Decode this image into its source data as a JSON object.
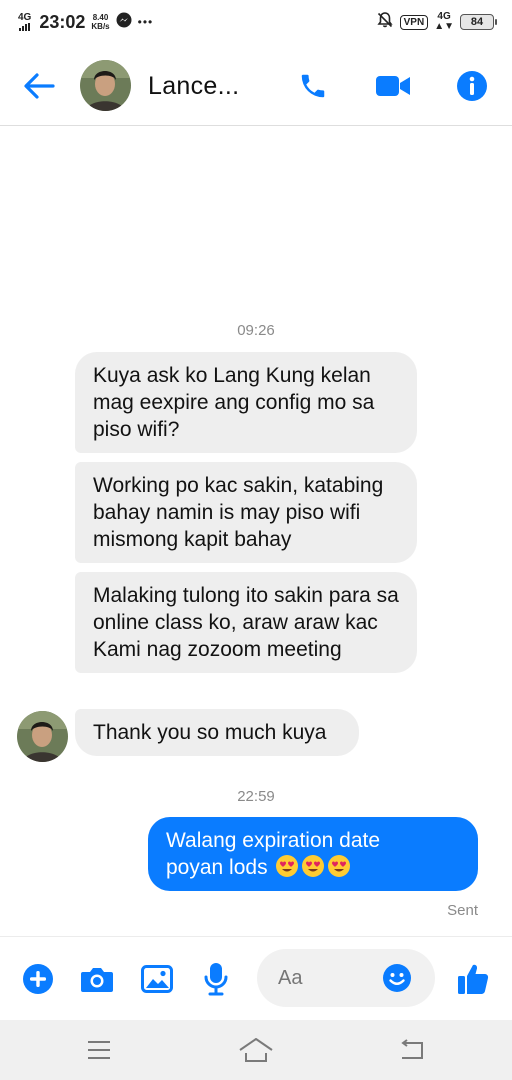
{
  "status_bar": {
    "network": "4G",
    "time": "23:02",
    "speed_value": "8.40",
    "speed_unit": "KB/s",
    "more": "•••",
    "vpn": "VPN",
    "network_right": "4G",
    "battery": "84"
  },
  "header": {
    "contact_name": "Lance...",
    "accent_color": "#0a7cff",
    "icons": [
      "back-arrow-icon",
      "phone-icon",
      "video-camera-icon",
      "info-icon"
    ]
  },
  "chat": {
    "timestamps": [
      "09:26",
      "22:59"
    ],
    "incoming": [
      {
        "text": "Kuya ask ko Lang Kung kelan mag eexpire ang config mo sa piso wifi?"
      },
      {
        "text": "Working po kac sakin, katabing bahay namin is may piso wifi mismong kapit bahay"
      },
      {
        "text": "Malaking tulong ito sakin para sa online class ko, araw araw kac Kami nag zozoom meeting"
      },
      {
        "text": "Thank you so much kuya"
      }
    ],
    "outgoing": {
      "line1": "Walang expiration date",
      "line2": "poyan lods",
      "emojis": [
        "heart-eyes-emoji",
        "heart-eyes-emoji",
        "heart-eyes-emoji"
      ]
    },
    "sent_label": "Sent",
    "incoming_bubble_color": "#eeeeee",
    "outgoing_bubble_color": "#0a7cff"
  },
  "composer": {
    "placeholder": "Aa",
    "icons": [
      "plus-icon",
      "camera-icon",
      "gallery-icon",
      "microphone-icon",
      "emoji-icon",
      "thumbs-up-icon"
    ]
  },
  "system_nav": {
    "icons": [
      "menu-icon",
      "home-icon",
      "back-icon"
    ]
  }
}
